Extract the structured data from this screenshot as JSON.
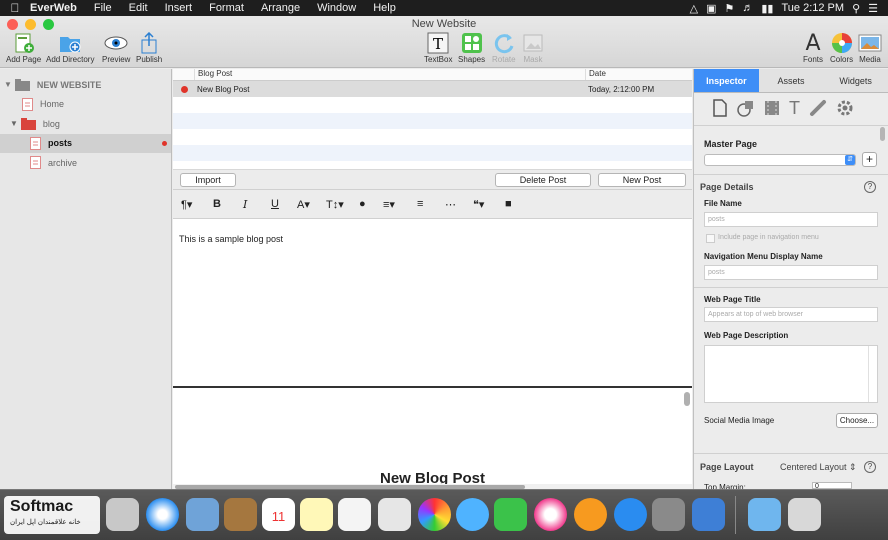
{
  "menubar": {
    "app": "EverWeb",
    "items": [
      "File",
      "Edit",
      "Insert",
      "Format",
      "Arrange",
      "Window",
      "Help"
    ],
    "clock": "Tue 2:12 PM"
  },
  "window": {
    "title": "New Website"
  },
  "toolbar": {
    "add_page": "Add Page",
    "add_directory": "Add Directory",
    "preview": "Preview",
    "publish": "Publish",
    "textbox": "TextBox",
    "shapes": "Shapes",
    "rotate": "Rotate",
    "mask": "Mask",
    "fonts": "Fonts",
    "colors": "Colors",
    "media": "Media"
  },
  "sidebar": {
    "site": "NEW WEBSITE",
    "home": "Home",
    "blog": "blog",
    "posts": "posts",
    "archive": "archive"
  },
  "posts_table": {
    "col_title": "Blog Post",
    "col_date": "Date",
    "rows": [
      {
        "title": "New Blog Post",
        "date": "Today, 2:12:00 PM"
      }
    ]
  },
  "buttons": {
    "import": "Import",
    "delete_post": "Delete Post",
    "new_post": "New Post"
  },
  "editor": {
    "body": "This is a sample blog post"
  },
  "preview": {
    "heading": "New Blog Post"
  },
  "inspector": {
    "tabs": [
      "Inspector",
      "Assets",
      "Widgets"
    ],
    "master_page": "Master Page",
    "page_details": "Page Details",
    "file_name_label": "File Name",
    "file_name_placeholder": "posts",
    "include_nav": "Include page in navigation menu",
    "nav_name_label": "Navigation Menu Display Name",
    "nav_name_placeholder": "posts",
    "web_title_label": "Web Page Title",
    "web_title_placeholder": "Appears at top of web browser",
    "web_desc_label": "Web Page Description",
    "social_label": "Social Media Image",
    "choose": "Choose...",
    "page_layout": "Page Layout",
    "layout_value": "Centered Layout",
    "top_margin": "Top Margin:",
    "top_margin_value": "0"
  },
  "watermark": {
    "brand": "Softmac",
    "tagline": "خانه علاقمندان اپل ایران"
  }
}
